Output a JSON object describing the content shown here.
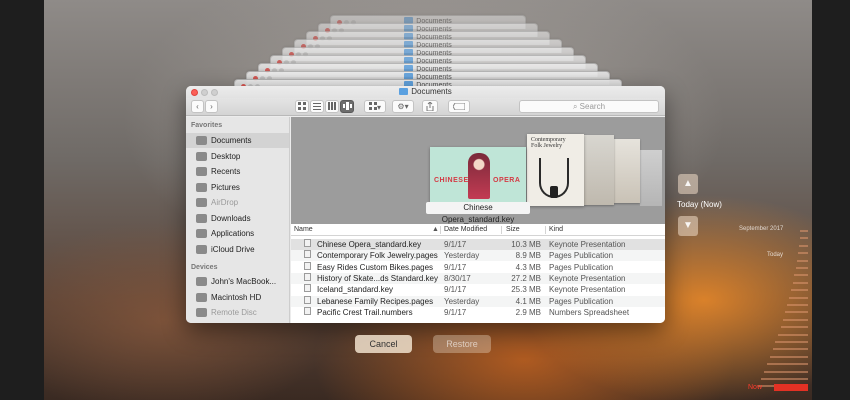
{
  "stack": {
    "label": "Documents"
  },
  "window": {
    "title": "Documents"
  },
  "toolbar": {
    "back": "‹",
    "forward": "›",
    "arrange": "▾",
    "action": "▾",
    "search_placeholder": "Search"
  },
  "sidebar": {
    "favorites_header": "Favorites",
    "favorites": [
      {
        "label": "Documents",
        "icon": "documents-icon",
        "selected": true
      },
      {
        "label": "Desktop",
        "icon": "desktop-icon"
      },
      {
        "label": "Recents",
        "icon": "recents-icon"
      },
      {
        "label": "Pictures",
        "icon": "pictures-icon"
      },
      {
        "label": "AirDrop",
        "icon": "airdrop-icon",
        "dimmed": true
      },
      {
        "label": "Downloads",
        "icon": "downloads-icon"
      },
      {
        "label": "Applications",
        "icon": "applications-icon"
      },
      {
        "label": "iCloud Drive",
        "icon": "icloud-icon"
      }
    ],
    "devices_header": "Devices",
    "devices": [
      {
        "label": "John's MacBook...",
        "icon": "laptop-icon"
      },
      {
        "label": "Macintosh HD",
        "icon": "disk-icon"
      },
      {
        "label": "Remote Disc",
        "icon": "disc-icon",
        "dimmed": true
      }
    ]
  },
  "preview": {
    "caption": "Chinese Opera_standard.key",
    "chinese_left": "CHINESE",
    "chinese_right": "OPERA",
    "jewelry_title": "Contemporary Folk Jewelry"
  },
  "list": {
    "headers": {
      "name": "Name",
      "date": "Date Modified",
      "size": "Size",
      "kind": "Kind"
    },
    "rows": [
      {
        "name": "Chinese Opera_standard.key",
        "date": "9/1/17",
        "size": "10.3 MB",
        "kind": "Keynote Presentation",
        "selected": true
      },
      {
        "name": "Contemporary Folk Jewelry.pages",
        "date": "Yesterday",
        "size": "8.9 MB",
        "kind": "Pages Publication"
      },
      {
        "name": "Easy Rides Custom Bikes.pages",
        "date": "9/1/17",
        "size": "4.3 MB",
        "kind": "Pages Publication"
      },
      {
        "name": "History of Skate...ds Standard.key",
        "date": "8/30/17",
        "size": "27.2 MB",
        "kind": "Keynote Presentation"
      },
      {
        "name": "Iceland_standard.key",
        "date": "9/1/17",
        "size": "25.3 MB",
        "kind": "Keynote Presentation"
      },
      {
        "name": "Lebanese Family Recipes.pages",
        "date": "Yesterday",
        "size": "4.1 MB",
        "kind": "Pages Publication"
      },
      {
        "name": "Pacific Crest Trail.numbers",
        "date": "9/1/17",
        "size": "2.9 MB",
        "kind": "Numbers Spreadsheet"
      }
    ]
  },
  "dialog": {
    "cancel": "Cancel",
    "restore": "Restore"
  },
  "time_machine": {
    "up": "▲",
    "down": "▼",
    "current": "Today (Now)",
    "labels": {
      "september": "September 2017",
      "today": "Today",
      "now": "Now"
    },
    "accent": "#e33124"
  }
}
